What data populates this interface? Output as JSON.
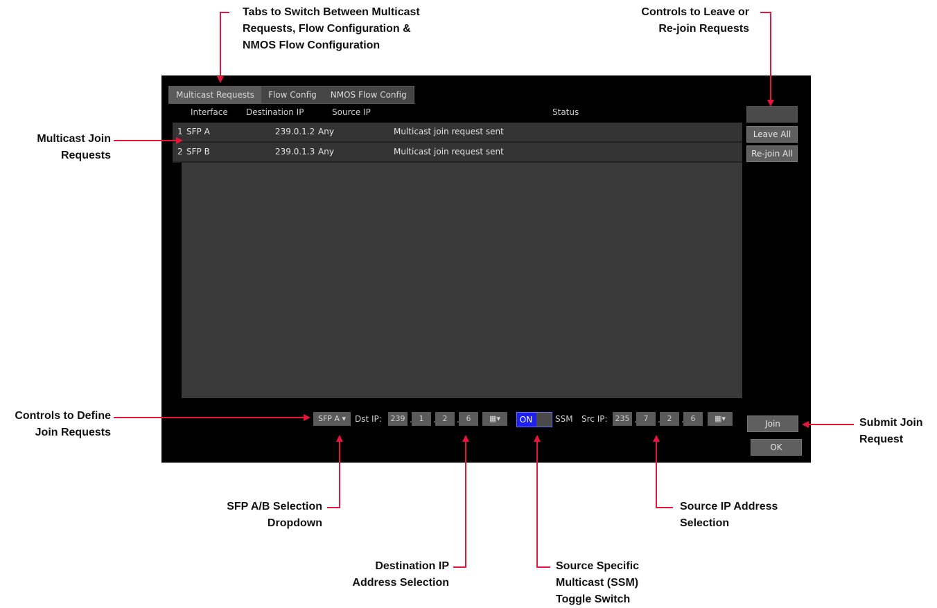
{
  "tabs": [
    "Multicast Requests",
    "Flow Config",
    "NMOS Flow Config"
  ],
  "columns": {
    "interface": "Interface",
    "destination_ip": "Destination IP",
    "source_ip": "Source IP",
    "status": "Status"
  },
  "rows": [
    {
      "index": "1",
      "interface": "SFP A",
      "destination_ip": "239.0.1.2",
      "source_ip": "Any",
      "status": "Multicast join request sent"
    },
    {
      "index": "2",
      "interface": "SFP B",
      "destination_ip": "239.0.1.3",
      "source_ip": "Any",
      "status": "Multicast join request sent"
    }
  ],
  "side_buttons": {
    "disabled": "",
    "leave_all": "Leave All",
    "rejoin_all": "Re-join All",
    "join": "Join",
    "ok": "OK"
  },
  "controls": {
    "sfp_select": "SFP A",
    "dst_label": "Dst IP:",
    "dst_octets": [
      "239",
      "1",
      "2",
      "6"
    ],
    "ssm_toggle": "ON",
    "ssm_label": "SSM",
    "src_label": "Src IP:",
    "src_octets": [
      "235",
      "7",
      "2",
      "6"
    ]
  },
  "annotations": {
    "tabs": [
      "Tabs to Switch Between Multicast",
      "Requests, Flow Configuration &",
      "NMOS Flow Configuration"
    ],
    "leave_rejoin": [
      "Controls to Leave or",
      "Re-join Requests"
    ],
    "join_requests": [
      "Multicast Join",
      "Requests"
    ],
    "define": [
      "Controls to Define",
      "Join Requests"
    ],
    "submit": [
      "Submit Join",
      "Request"
    ],
    "sfp": [
      "SFP A/B Selection",
      "Dropdown"
    ],
    "dst": [
      "Destination IP",
      "Address Selection"
    ],
    "ssm": [
      "Source Specific",
      "Multicast (SSM)",
      "Toggle Switch"
    ],
    "src": [
      "Source IP Address",
      "Selection"
    ]
  },
  "colors": {
    "arrow": "#e8143c",
    "toggle_on": "#1e20ee"
  }
}
